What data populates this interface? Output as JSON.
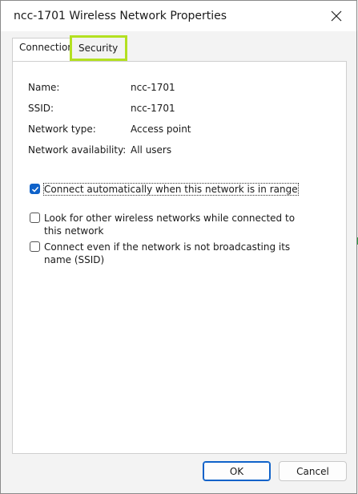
{
  "window": {
    "title": "ncc-1701 Wireless Network Properties"
  },
  "tabs": {
    "connection": "Connection",
    "security": "Security",
    "highlight_color": "#b3e021"
  },
  "properties": {
    "name_label": "Name:",
    "name_value": "ncc-1701",
    "ssid_label": "SSID:",
    "ssid_value": "ncc-1701",
    "type_label": "Network type:",
    "type_value": "Access point",
    "availability_label": "Network availability:",
    "availability_value": "All users"
  },
  "options": {
    "auto_connect": {
      "label": "Connect automatically when this network is in range",
      "checked": true
    },
    "look_other": {
      "label": "Look for other wireless networks while connected to this network",
      "checked": false
    },
    "connect_hidden": {
      "label": "Connect even if the network is not broadcasting its name (SSID)",
      "checked": false
    }
  },
  "buttons": {
    "ok": "OK",
    "cancel": "Cancel"
  },
  "colors": {
    "accent": "#0f62c9"
  }
}
